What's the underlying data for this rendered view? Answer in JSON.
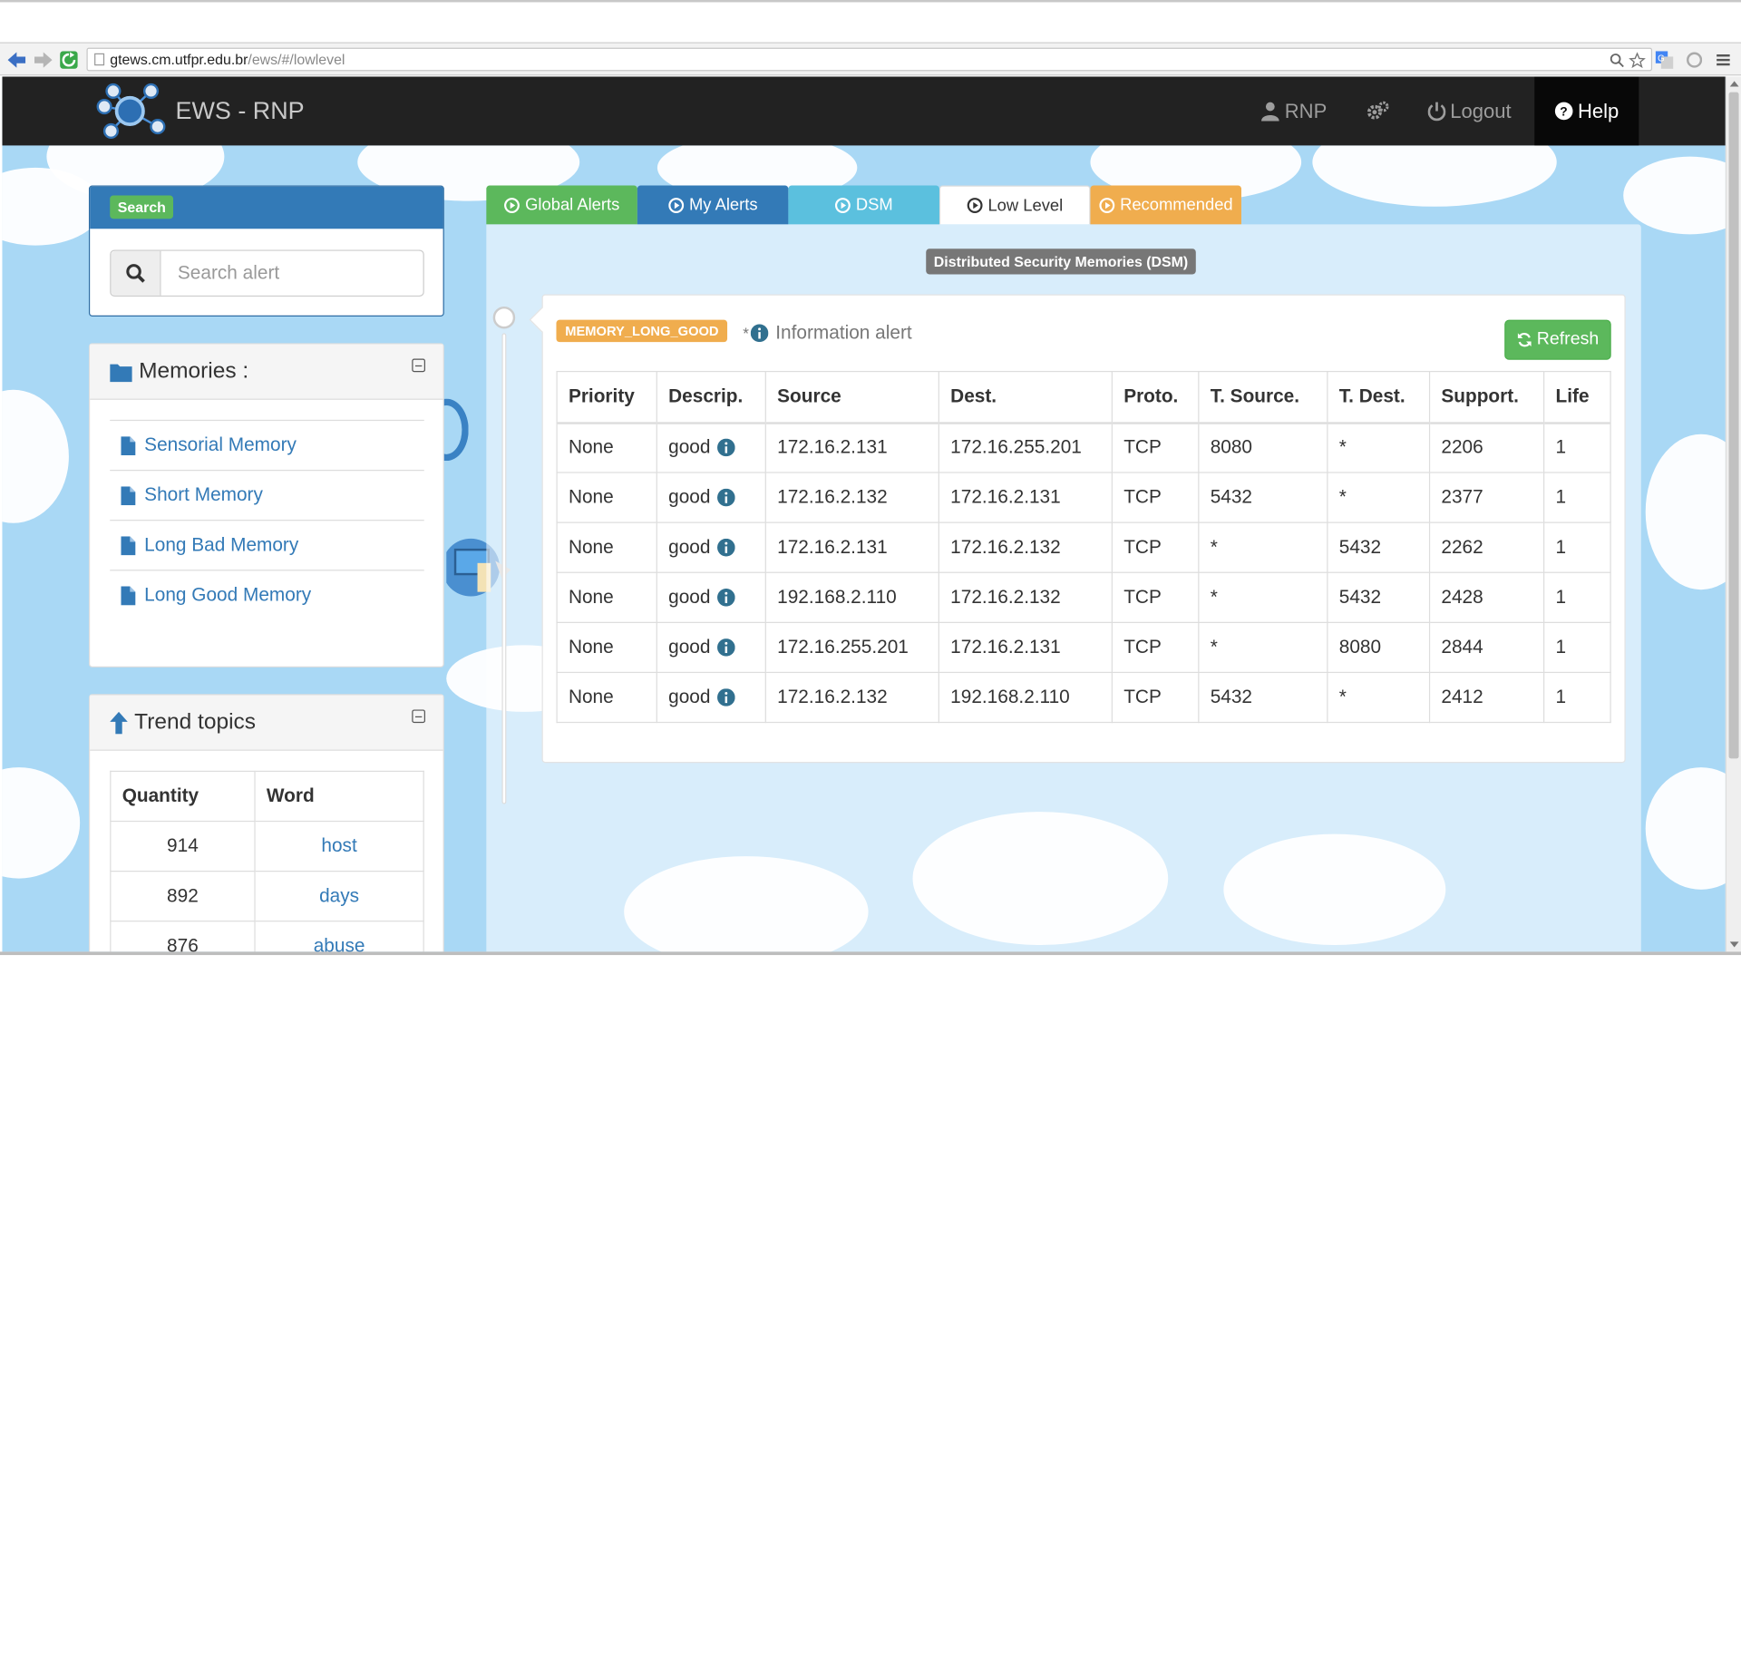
{
  "browser": {
    "url_host": "gtews.cm.utfpr.edu.br",
    "url_path": "/ews/#/lowlevel"
  },
  "navbar": {
    "brand": "EWS - RNP",
    "user_label": "RNP",
    "logout_label": "Logout",
    "help_label": "Help"
  },
  "search": {
    "badge": "Search",
    "placeholder": "Search alert"
  },
  "memories": {
    "title": "Memories :",
    "items": [
      {
        "label": "Sensorial Memory"
      },
      {
        "label": "Short Memory"
      },
      {
        "label": "Long Bad Memory"
      },
      {
        "label": "Long Good Memory"
      }
    ]
  },
  "trend": {
    "title": "Trend topics",
    "headers": {
      "quantity": "Quantity",
      "word": "Word"
    },
    "rows": [
      {
        "quantity": "914",
        "word": "host"
      },
      {
        "quantity": "892",
        "word": "days"
      },
      {
        "quantity": "876",
        "word": "abuse"
      }
    ]
  },
  "tabs": [
    {
      "label": "Global Alerts",
      "color": "#5cb85c"
    },
    {
      "label": "My Alerts",
      "color": "#337ab7"
    },
    {
      "label": "DSM",
      "color": "#5bc0de"
    },
    {
      "label": "Low Level",
      "color": "#ffffff"
    },
    {
      "label": "Recommended",
      "color": "#f0ad4e"
    }
  ],
  "main": {
    "section_label": "Distributed Security Memories (DSM)",
    "alert": {
      "badge": "MEMORY_LONG_GOOD",
      "star": "*",
      "title": "Information alert",
      "refresh_label": "Refresh",
      "headers": [
        "Priority",
        "Descrip.",
        "Source",
        "Dest.",
        "Proto.",
        "T. Source.",
        "T. Dest.",
        "Support.",
        "Life"
      ],
      "rows": [
        [
          "None",
          "good",
          "172.16.2.131",
          "172.16.255.201",
          "TCP",
          "8080",
          "*",
          "2206",
          "1"
        ],
        [
          "None",
          "good",
          "172.16.2.132",
          "172.16.2.131",
          "TCP",
          "5432",
          "*",
          "2377",
          "1"
        ],
        [
          "None",
          "good",
          "172.16.2.131",
          "172.16.2.132",
          "TCP",
          "*",
          "5432",
          "2262",
          "1"
        ],
        [
          "None",
          "good",
          "192.168.2.110",
          "172.16.2.132",
          "TCP",
          "*",
          "5432",
          "2428",
          "1"
        ],
        [
          "None",
          "good",
          "172.16.255.201",
          "172.16.2.131",
          "TCP",
          "*",
          "8080",
          "2844",
          "1"
        ],
        [
          "None",
          "good",
          "172.16.2.132",
          "192.168.2.110",
          "TCP",
          "5432",
          "*",
          "2412",
          "1"
        ]
      ]
    }
  },
  "colors": {
    "navbar_bg": "#222222",
    "primary": "#337ab7",
    "success": "#5cb85c",
    "info": "#5bc0de",
    "warning": "#f0ad4e",
    "sky": "#a9d8f5"
  }
}
